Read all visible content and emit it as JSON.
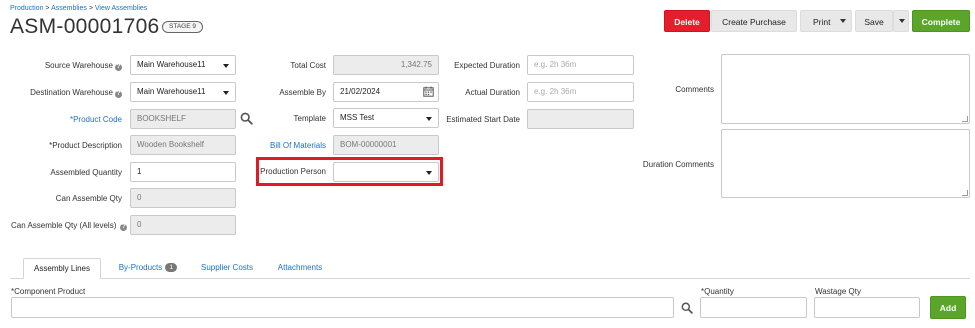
{
  "breadcrumb": {
    "items": [
      "Production",
      "Assemblies",
      "View Assemblies"
    ],
    "separator": ">"
  },
  "title": "ASM-00001706",
  "stage_badge": "STAGE 9",
  "toolbar": {
    "delete_label": "Delete",
    "create_purchase_label": "Create Purchase",
    "print_label": "Print",
    "save_label": "Save",
    "complete_label": "Complete"
  },
  "form": {
    "source_warehouse": {
      "label": "Source Warehouse",
      "value": "Main Warehouse11"
    },
    "destination_warehouse": {
      "label": "Destination Warehouse",
      "value": "Main Warehouse11"
    },
    "product_code": {
      "label": "*Product Code",
      "value": "BOOKSHELF"
    },
    "product_description": {
      "label": "*Product Description",
      "value": "Wooden Bookshelf"
    },
    "assembled_quantity": {
      "label": "Assembled Quantity",
      "value": "1"
    },
    "can_assemble_qty": {
      "label": "Can Assemble Qty",
      "value": "0"
    },
    "can_assemble_qty_all": {
      "label": "Can Assemble Qty (All levels)",
      "value": "0"
    },
    "total_cost": {
      "label": "Total Cost",
      "value": "1,342.75"
    },
    "assemble_by": {
      "label": "Assemble By",
      "value": "21/02/2024"
    },
    "template": {
      "label": "Template",
      "value": "MSS Test"
    },
    "bill_of_materials": {
      "label": "Bill Of Materials",
      "value": "BOM-00000001"
    },
    "production_person": {
      "label": "Production Person",
      "value": ""
    },
    "expected_duration": {
      "label": "Expected Duration",
      "placeholder": "e.g. 2h 36m"
    },
    "actual_duration": {
      "label": "Actual Duration",
      "placeholder": "e.g. 2h 36m"
    },
    "estimated_start_date": {
      "label": "Estimated Start Date",
      "value": ""
    },
    "comments": {
      "label": "Comments"
    },
    "duration_comments": {
      "label": "Duration Comments"
    }
  },
  "tabs": [
    {
      "label": "Assembly Lines",
      "active": true
    },
    {
      "label": "By-Products",
      "badge": "1"
    },
    {
      "label": "Supplier Costs"
    },
    {
      "label": "Attachments"
    }
  ],
  "lines": {
    "component_product_label": "*Component Product",
    "quantity_label": "*Quantity",
    "wastage_qty_label": "Wastage Qty",
    "add_label": "Add"
  },
  "colors": {
    "danger": "#e41e2b",
    "success": "#5aa52a",
    "link": "#1a73c8",
    "highlight": "#e01b24"
  },
  "icons": [
    "help-icon",
    "search-icon",
    "calendar-icon",
    "chevron-down-icon"
  ]
}
